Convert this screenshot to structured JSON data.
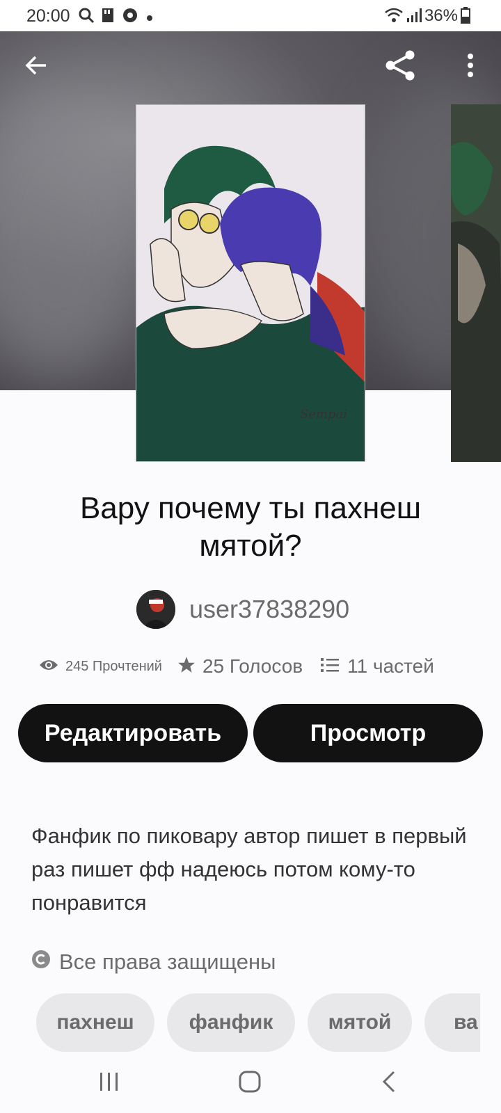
{
  "status_bar": {
    "time": "20:00",
    "battery": "36%",
    "icons": [
      "search-icon",
      "sd-card-icon",
      "chrome-icon",
      "dot-icon",
      "wifi-icon",
      "signal-icon",
      "battery-icon"
    ]
  },
  "toolbar": {
    "back_icon": "arrow-left-icon",
    "share_icon": "share-icon",
    "menu_icon": "more-vertical-icon"
  },
  "story": {
    "title": "Вару почему ты пахнеш мятой?",
    "author": "user37838290",
    "stats": {
      "reads": "245 Прочтений",
      "votes": "25 Голосов",
      "parts": "11 частей"
    },
    "buttons": {
      "edit": "Редактировать",
      "view": "Просмотр"
    },
    "description": "Фанфик по пиковару автор пишет в первый раз пишет фф надеюсь потом кому-то понравится",
    "copyright": "Все права защищены",
    "tags": [
      "пахнеш",
      "фанфик",
      "мятой",
      "ва"
    ]
  },
  "colors": {
    "primary": "#121212",
    "muted_text": "#6b6b6b",
    "tag_bg": "#e8e7ea",
    "background": "#fbfbfd"
  }
}
